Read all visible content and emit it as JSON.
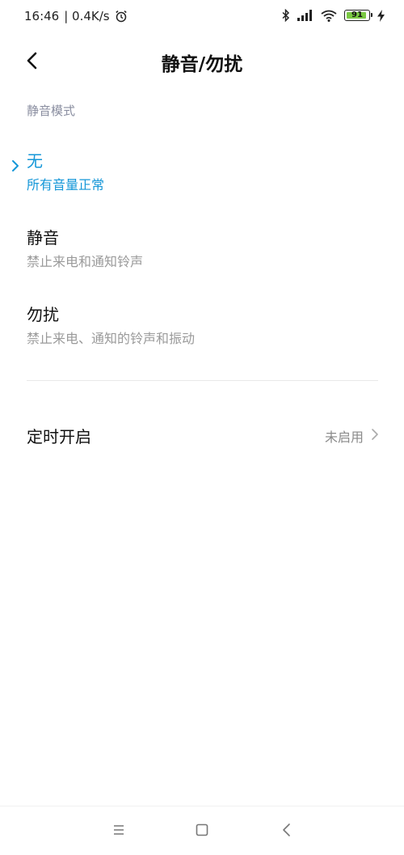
{
  "status_bar": {
    "time": "16:46",
    "speed": "| 0.4K/s",
    "battery_level": "91",
    "battery_color": "#7ac943"
  },
  "header": {
    "title": "静音/勿扰",
    "back_icon": "chevron-left-icon"
  },
  "section": {
    "label": "静音模式"
  },
  "options": [
    {
      "title": "无",
      "description": "所有音量正常",
      "selected": true
    },
    {
      "title": "静音",
      "description": "禁止来电和通知铃声",
      "selected": false
    },
    {
      "title": "勿扰",
      "description": "禁止来电、通知的铃声和振动",
      "selected": false
    }
  ],
  "schedule": {
    "label": "定时开启",
    "value": "未启用"
  },
  "accent_color": "#1597d8",
  "nav_bar": {
    "icons": [
      "menu-icon",
      "home-square-icon",
      "back-triangle-icon"
    ]
  }
}
